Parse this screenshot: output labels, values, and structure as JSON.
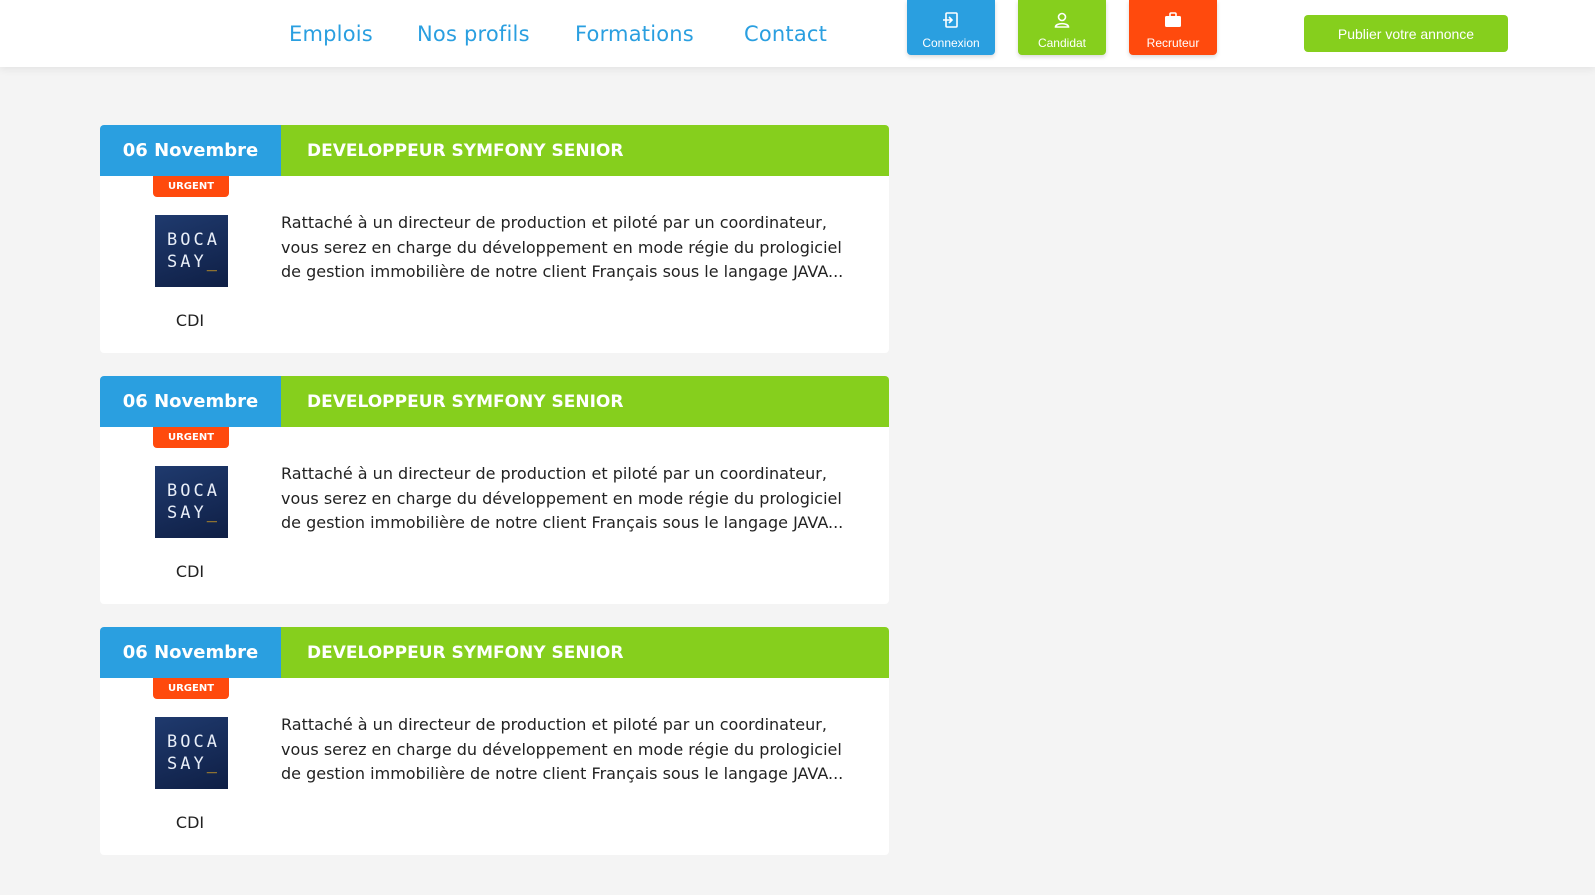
{
  "colors": {
    "blue": "#2a9fe0",
    "green": "#86cf1d",
    "orange": "#ff4a0d",
    "white": "#ffffff"
  },
  "nav": {
    "links": [
      "Emplois",
      "Nos profils",
      "Formations",
      "Contact"
    ]
  },
  "tiles": {
    "connexion": {
      "label": "Connexion",
      "icon": "login-icon"
    },
    "candidat": {
      "label": "Candidat",
      "icon": "user-icon"
    },
    "recruteur": {
      "label": "Recruteur",
      "icon": "briefcase-icon"
    }
  },
  "publish_button": "Publier votre annonce",
  "jobs": [
    {
      "date": "06 Novembre",
      "title": "DEVELOPPEUR SYMFONY SENIOR",
      "badge": "URGENT",
      "logo_line1": "BOCA",
      "logo_line2": "SAY",
      "logo_cursor": "_",
      "contract": "CDI",
      "description": "Rattaché à un directeur de production et piloté par un coordinateur, vous serez en charge du développement en mode régie du prologiciel de gestion immobilière de notre client Français sous le langage JAVA..."
    },
    {
      "date": "06 Novembre",
      "title": "DEVELOPPEUR SYMFONY SENIOR",
      "badge": "URGENT",
      "logo_line1": "BOCA",
      "logo_line2": "SAY",
      "logo_cursor": "_",
      "contract": "CDI",
      "description": "Rattaché à un directeur de production et piloté par un coordinateur, vous serez en charge du développement en mode régie du prologiciel de gestion immobilière de notre client Français sous le langage JAVA..."
    },
    {
      "date": "06 Novembre",
      "title": "DEVELOPPEUR SYMFONY SENIOR",
      "badge": "URGENT",
      "logo_line1": "BOCA",
      "logo_line2": "SAY",
      "logo_cursor": "_",
      "contract": "CDI",
      "description": "Rattaché à un directeur de production et piloté par un coordinateur, vous serez en charge du développement en mode régie du prologiciel de gestion immobilière de notre client Français sous le langage JAVA..."
    }
  ]
}
